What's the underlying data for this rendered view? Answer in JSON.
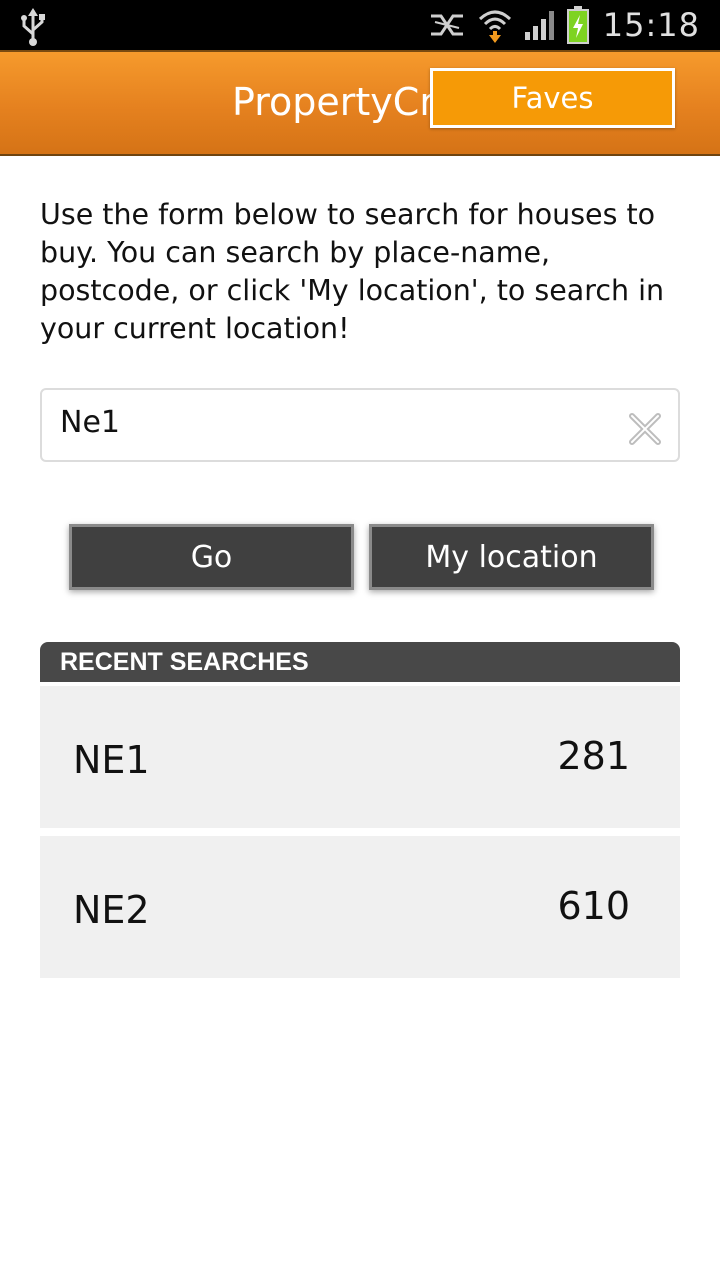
{
  "status_bar": {
    "time": "15:18",
    "icons": [
      "usb-icon",
      "nfc-icon",
      "wifi-icon",
      "signal-icon",
      "battery-charging-icon"
    ],
    "battery_color": "#7ed321"
  },
  "header": {
    "title": "PropertyCross",
    "faves_label": "Faves",
    "accent_color": "#e5811f"
  },
  "intro": {
    "text": "Use the form below to search for houses to buy. You can search by place-name, postcode, or click 'My location', to search in your current location!"
  },
  "search": {
    "value": "Ne1",
    "clear_icon": "clear-icon"
  },
  "buttons": {
    "go_label": "Go",
    "location_label": "My location"
  },
  "recent": {
    "header": "RECENT SEARCHES",
    "items": [
      {
        "name": "NE1",
        "count": "281"
      },
      {
        "name": "NE2",
        "count": "610"
      }
    ]
  }
}
